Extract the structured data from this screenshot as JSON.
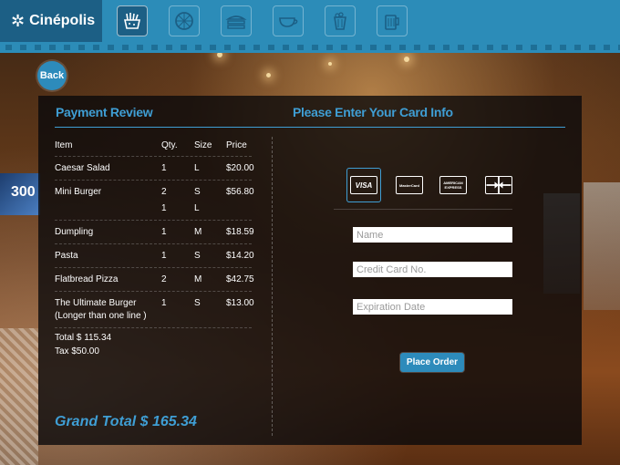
{
  "brand": {
    "name": "Cinépolis"
  },
  "categories": [
    {
      "icon": "snack-box-icon",
      "active": true
    },
    {
      "icon": "pizza-icon",
      "active": false
    },
    {
      "icon": "sandwich-icon",
      "active": false
    },
    {
      "icon": "coffee-cup-icon",
      "active": false
    },
    {
      "icon": "popcorn-icon",
      "active": false
    },
    {
      "icon": "beer-mug-icon",
      "active": false
    }
  ],
  "back_label": "Back",
  "payment_review": {
    "title": "Payment Review",
    "columns": {
      "item": "Item",
      "qty": "Qty.",
      "size": "Size",
      "price": "Price"
    },
    "items": [
      {
        "item": "Caesar Salad",
        "qty": "1",
        "size": "L",
        "price": "$20.00"
      },
      {
        "item": "Mini Burger",
        "qty": "2",
        "size": "S",
        "price": "$56.80",
        "sub_qty": "1",
        "sub_size": "L"
      },
      {
        "item": "Dumpling",
        "qty": "1",
        "size": "M",
        "price": "$18.59"
      },
      {
        "item": "Pasta",
        "qty": "1",
        "size": "S",
        "price": "$14.20"
      },
      {
        "item": "Flatbread Pizza",
        "qty": "2",
        "size": "M",
        "price": "$42.75"
      },
      {
        "item": "The Ultimate Burger",
        "item_line2": "(Longer than one line )",
        "qty": "1",
        "size": "S",
        "price": "$13.00"
      }
    ],
    "total": "Total $ 115.34",
    "tax": "Tax $50.00",
    "grand_total": "Grand Total $ 165.34"
  },
  "card_info": {
    "title": "Please Enter Your Card Info",
    "cards": [
      {
        "label": "VISA",
        "icon": "visa-card-icon",
        "selected": true
      },
      {
        "label": "MasterCard",
        "icon": "mastercard-icon",
        "selected": false
      },
      {
        "label": "AMERICAN EXPRESS",
        "icon": "amex-card-icon",
        "selected": false
      },
      {
        "label": "",
        "icon": "gift-card-icon",
        "selected": false
      }
    ],
    "name_placeholder": "Name",
    "card_number_placeholder": "Credit Card No.",
    "expiration_placeholder": "Expiration Date",
    "place_order_label": "Place Order"
  },
  "colors": {
    "accent": "#3f9ed4",
    "topbar": "#2c8cb8",
    "logo_bg": "#1c5f85",
    "button": "#2d8bbb"
  }
}
